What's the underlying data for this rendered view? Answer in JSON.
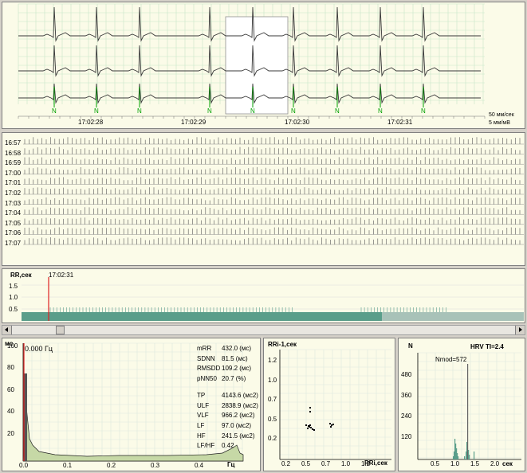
{
  "ecg": {
    "times": [
      "17:02:28",
      "17:02:29",
      "17:02:30",
      "17:02:31"
    ],
    "beat_marker": "N",
    "speed": "50 мм/сек",
    "gain": "5 мм/мВ"
  },
  "trend": {
    "hours": [
      "16:57",
      "16:58",
      "16:59",
      "17:00",
      "17:01",
      "17:02",
      "17:03",
      "17:04",
      "17:05",
      "17:06",
      "17:07"
    ]
  },
  "rr_trend": {
    "ylabel": "RR,сек",
    "cursor_time": "17:02:31",
    "yticks": [
      "1.5",
      "1.0",
      "0.5"
    ]
  },
  "spectrum": {
    "ylabel": "мс",
    "cursor_readout": "0.000 Гц",
    "xlabel": "Гц",
    "yticks": [
      "100",
      "80",
      "60",
      "40",
      "20"
    ],
    "xticks": [
      "0.0",
      "0.1",
      "0.2",
      "0.3",
      "0.4"
    ],
    "stats": [
      {
        "name": "mRR",
        "value": "432.0 (мс)"
      },
      {
        "name": "SDNN",
        "value": "81.5 (мс)"
      },
      {
        "name": "RMSDD",
        "value": "109.2 (мс)"
      },
      {
        "name": "pNN50",
        "value": "20.7 (%)"
      },
      {
        "name": "TP",
        "value": "4143.6 (мс2)"
      },
      {
        "name": "ULF",
        "value": "2838.9 (мс2)"
      },
      {
        "name": "VLF",
        "value": "966.2 (мс2)"
      },
      {
        "name": "LF",
        "value": "97.0 (мс2)"
      },
      {
        "name": "HF",
        "value": "241.5 (мс2)"
      },
      {
        "name": "LF/HF",
        "value": "0.42"
      }
    ]
  },
  "scatter": {
    "ylabel": "RRi-1,сек",
    "xlabel": "RRi,сек",
    "yticks": [
      "1.2",
      "1.0",
      "0.7",
      "0.5",
      "0.2"
    ],
    "xticks": [
      "0.2",
      "0.5",
      "0.7",
      "1.0",
      "1.2"
    ]
  },
  "histogram": {
    "ylabel": "N",
    "title": "HRV TI=2.4",
    "annotation": "Nmod=572",
    "xlabel": "сек",
    "yticks": [
      "480",
      "360",
      "240",
      "120"
    ],
    "xticks": [
      "0.5",
      "1.0",
      "1.5",
      "2.0"
    ]
  },
  "colors": {
    "panel_bg": "#fbfbe8",
    "grid": "#c8e6c8",
    "trace": "#3a3a3a",
    "marker": "#00a000",
    "cursor": "#e02020",
    "fill": "#5a9e8a"
  }
}
